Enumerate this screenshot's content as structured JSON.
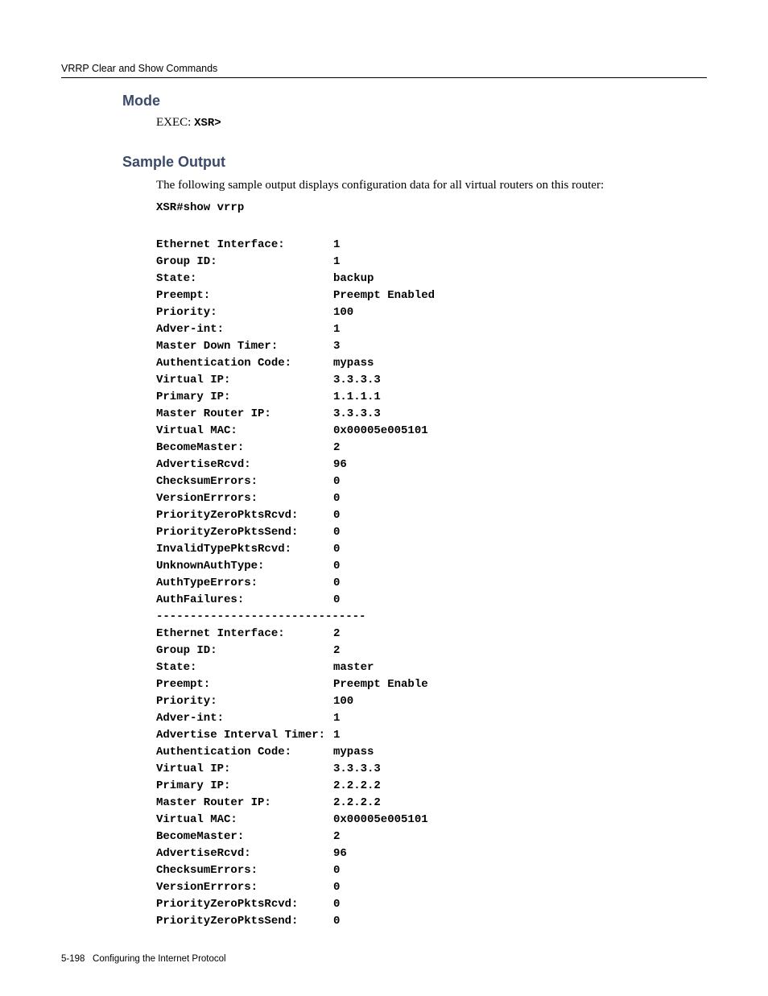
{
  "header": "VRRP Clear and Show Commands",
  "sections": {
    "mode": {
      "heading": "Mode",
      "exec_label": "EXEC: ",
      "exec_prompt": "XSR>"
    },
    "sample": {
      "heading": "Sample Output",
      "intro": "The following sample output displays configuration data for all virtual routers on this router:",
      "command": "XSR#show vrrp"
    }
  },
  "output": {
    "group1": [
      {
        "label": "Ethernet Interface:",
        "value": "1"
      },
      {
        "label": "Group ID:",
        "value": "1"
      },
      {
        "label": "State:",
        "value": "backup"
      },
      {
        "label": "Preempt:",
        "value": "Preempt Enabled"
      },
      {
        "label": "Priority:",
        "value": "100"
      },
      {
        "label": "Adver-int:",
        "value": "1"
      },
      {
        "label": "Master Down Timer:",
        "value": "3"
      },
      {
        "label": "Authentication Code:",
        "value": "mypass"
      },
      {
        "label": "Virtual IP:",
        "value": "3.3.3.3"
      },
      {
        "label": "Primary IP:",
        "value": "1.1.1.1"
      },
      {
        "label": "Master Router IP:",
        "value": "3.3.3.3"
      },
      {
        "label": "Virtual MAC:",
        "value": "0x00005e005101"
      },
      {
        "label": "BecomeMaster:",
        "value": "2"
      },
      {
        "label": "AdvertiseRcvd:",
        "value": "96"
      },
      {
        "label": "ChecksumErrors:",
        "value": "0"
      },
      {
        "label": "VersionErrrors:",
        "value": "0"
      },
      {
        "label": "PriorityZeroPktsRcvd:",
        "value": "0"
      },
      {
        "label": "PriorityZeroPktsSend:",
        "value": "0"
      },
      {
        "label": "InvalidTypePktsRcvd:",
        "value": "0"
      },
      {
        "label": "UnknownAuthType:",
        "value": "0"
      },
      {
        "label": "AuthTypeErrors:",
        "value": "0"
      },
      {
        "label": "AuthFailures:",
        "value": "0"
      }
    ],
    "divider": "-------------------------------",
    "group2": [
      {
        "label": "Ethernet Interface:",
        "value": "2"
      },
      {
        "label": "Group ID:",
        "value": "2"
      },
      {
        "label": "State:",
        "value": "master"
      },
      {
        "label": "Preempt:",
        "value": "Preempt Enable"
      },
      {
        "label": "Priority:",
        "value": "100"
      },
      {
        "label": "Adver-int:",
        "value": "1"
      },
      {
        "label": "Advertise Interval Timer:",
        "value": "1"
      },
      {
        "label": "Authentication Code:",
        "value": "mypass"
      },
      {
        "label": "Virtual IP:",
        "value": "3.3.3.3"
      },
      {
        "label": "Primary IP:",
        "value": "2.2.2.2"
      },
      {
        "label": "Master Router IP:",
        "value": "2.2.2.2"
      },
      {
        "label": "Virtual MAC:",
        "value": "0x00005e005101"
      },
      {
        "label": "BecomeMaster:",
        "value": "2"
      },
      {
        "label": "AdvertiseRcvd:",
        "value": "96"
      },
      {
        "label": "ChecksumErrors:",
        "value": "0"
      },
      {
        "label": "VersionErrrors:",
        "value": "0"
      },
      {
        "label": "PriorityZeroPktsRcvd:",
        "value": "0"
      },
      {
        "label": "PriorityZeroPktsSend:",
        "value": "0"
      }
    ]
  },
  "footer": {
    "page_ref": "5-198",
    "title": "Configuring the Internet Protocol"
  }
}
